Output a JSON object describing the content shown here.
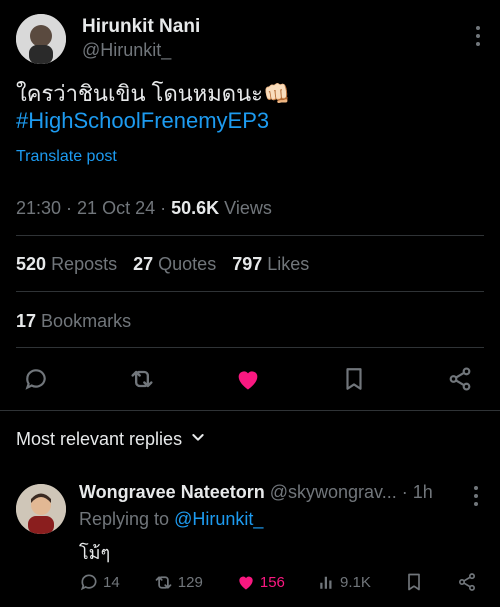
{
  "post": {
    "author_name": "Hirunkit Nani",
    "author_handle": "@Hirunkit_",
    "text": "ใครว่าชินเขิน โดนหมดนะ👊🏻",
    "hashtag": "#HighSchoolFrenemyEP3",
    "translate_label": "Translate post",
    "time": "21:30",
    "date": "21 Oct 24",
    "views_count": "50.6K",
    "views_label": "Views",
    "reposts_count": "520",
    "reposts_label": "Reposts",
    "quotes_count": "27",
    "quotes_label": "Quotes",
    "likes_count": "797",
    "likes_label": "Likes",
    "bookmarks_count": "17",
    "bookmarks_label": "Bookmarks"
  },
  "replies_sort_label": "Most relevant replies",
  "reply": {
    "author_name": "Wongravee Nateetorn",
    "author_handle": "@skywongrav...",
    "time": "· 1h",
    "replying_prefix": "Replying to",
    "replying_handle": "@Hirunkit_",
    "text": "โม้ๆ",
    "comments": "14",
    "reposts": "129",
    "likes": "156",
    "views": "9.1K"
  },
  "colors": {
    "accent": "#1d9bf0",
    "like": "#f91880",
    "muted": "#71767b",
    "border": "#2f3336"
  }
}
